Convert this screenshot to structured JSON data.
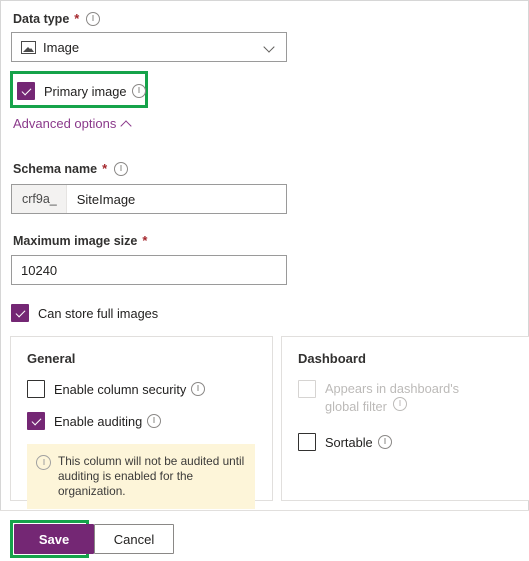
{
  "form": {
    "data_type": {
      "label": "Data type",
      "required_marker": "*",
      "info_icon": "info-icon",
      "selected_value": "Image",
      "value_icon": "image-icon",
      "chevron": "chevron-down-icon"
    },
    "primary_image": {
      "label": "Primary image",
      "checked": true,
      "info_icon": "info-icon",
      "highlight_color": "#16a34a"
    },
    "advanced_options": {
      "label": "Advanced options",
      "chevron": "chevron-up-icon",
      "link_color": "#8b3a8b"
    },
    "schema_name": {
      "label": "Schema name",
      "required_marker": "*",
      "info_icon": "info-icon",
      "prefix": "crf9a_",
      "value": "SiteImage"
    },
    "maximum_image_size": {
      "label": "Maximum image size",
      "required_marker": "*",
      "value": "10240"
    },
    "can_store_full_images": {
      "label": "Can store full images",
      "checked": true
    }
  },
  "general_panel": {
    "title": "General",
    "items": [
      {
        "label": "Enable column security",
        "checked": false,
        "disabled": false,
        "info_icon": "info-icon"
      },
      {
        "label": "Enable auditing",
        "checked": true,
        "disabled": false,
        "info_icon": "info-icon"
      }
    ],
    "warning": {
      "icon": "info-icon",
      "text": "This column will not be audited until auditing is enabled for the organization.",
      "background": "#fdf5d9"
    }
  },
  "dashboard_panel": {
    "title": "Dashboard",
    "items": [
      {
        "label": "Appears in dashboard's global filter",
        "checked": false,
        "disabled": true,
        "info_icon": "info-icon"
      },
      {
        "label": "Sortable",
        "checked": false,
        "disabled": false,
        "info_icon": "info-icon"
      }
    ]
  },
  "footer": {
    "save_label": "Save",
    "cancel_label": "Cancel",
    "save_color": "#742774",
    "save_highlight_color": "#16a34a"
  }
}
